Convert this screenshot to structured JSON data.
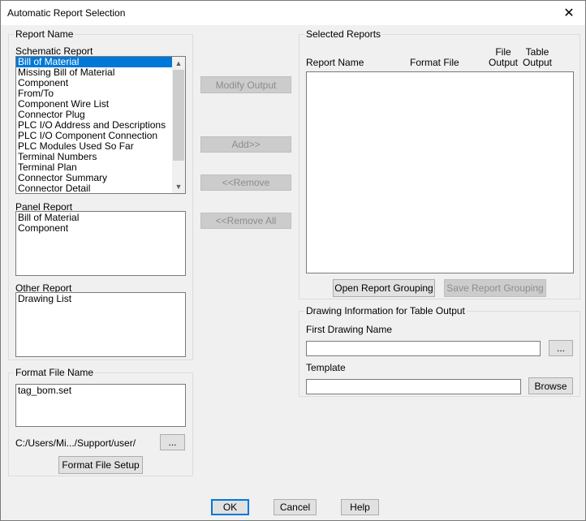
{
  "window": {
    "title": "Automatic Report Selection",
    "close_glyph": "✕"
  },
  "report_name": {
    "group_title": "Report Name",
    "schematic_label": "Schematic Report",
    "schematic_items": [
      "Bill of Material",
      "Missing Bill of Material",
      "Component",
      "From/To",
      "Component Wire List",
      "Connector Plug",
      "PLC I/O Address and Descriptions",
      "PLC I/O Component Connection",
      "PLC Modules Used So Far",
      "Terminal Numbers",
      "Terminal Plan",
      "Connector Summary",
      "Connector Detail"
    ],
    "schematic_selected_index": 0,
    "panel_label": "Panel Report",
    "panel_items": [
      "Bill of Material",
      "Component"
    ],
    "other_label": "Other Report",
    "other_items": [
      "Drawing List"
    ]
  },
  "format_file": {
    "group_title": "Format File Name",
    "files": [
      "tag_bom.set"
    ],
    "path": "C:/Users/Mi.../Support/user/",
    "browse_label": "...",
    "setup_label": "Format File Setup"
  },
  "middle_buttons": {
    "modify_output": "Modify Output",
    "add": "Add>>",
    "remove": "<<Remove",
    "remove_all": "<<Remove All"
  },
  "selected_reports": {
    "group_title": "Selected Reports",
    "columns": {
      "report_name": "Report Name",
      "format_file": "Format File",
      "file_output_1": "File",
      "file_output_2": "Output",
      "table_output_1": "Table",
      "table_output_2": "Output"
    },
    "open_grouping": "Open Report Grouping",
    "save_grouping": "Save Report Grouping"
  },
  "drawing_info": {
    "group_title": "Drawing Information for Table Output",
    "first_drawing_label": "First Drawing Name",
    "first_drawing_value": "",
    "first_drawing_browse": "...",
    "template_label": "Template",
    "template_value": "",
    "template_browse": "Browse"
  },
  "footer": {
    "ok": "OK",
    "cancel": "Cancel",
    "help": "Help"
  }
}
